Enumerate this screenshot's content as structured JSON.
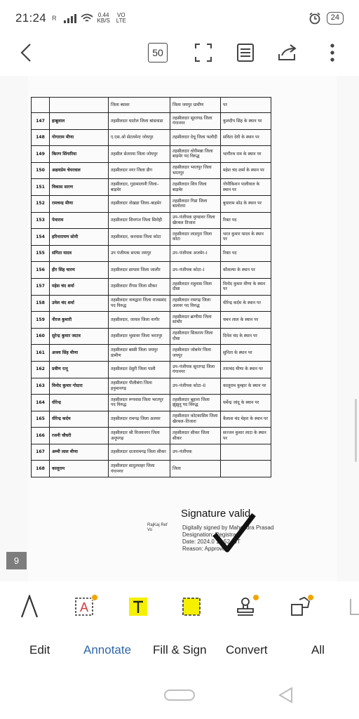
{
  "status_bar": {
    "time": "21:24",
    "net_speed_value": "0.44",
    "net_speed_unit": "KB/S",
    "volte_top": "VO",
    "volte_bottom": "LTE",
    "battery": "24"
  },
  "toolbar": {
    "page_count": "50"
  },
  "document": {
    "header": {
      "from": "जिला ब्यावर",
      "to": "जिला जयपुर ग्रामीण",
      "post": "पर"
    },
    "rows": [
      {
        "num": "147",
        "name": "हाबूलाल",
        "from": "तहसीलदार घाटोल जिला बांसवाडा",
        "to": "तहसीलदार सूरतगढ जिला गंगानगर",
        "post": "कुलदीप सिंह के स्थान पर"
      },
      {
        "num": "148",
        "name": "गोगाराम मीणा",
        "from": "ए.एस.ओ सेटलमेन्ट जोधपुर",
        "to": "तहसीलदार देचू जिला फलौदी",
        "post": "सविता देवी के स्थान पर"
      },
      {
        "num": "149",
        "name": "किरण सिंगारिया",
        "from": "तहसील सेतराया जिला जोधपुर",
        "to": "तहसीलदार धोरीमन्ना जिला बाड़मेर पद विरुद्ध",
        "post": "भागीरथ राम के स्थान पर"
      },
      {
        "num": "150",
        "name": "अक्षयप्रेम चेयरवाल",
        "from": "तहसीलदार नगर जिला डीग",
        "to": "तहसीलदार भरतपुर जिला भरतपुर",
        "post": "महेश चंद शर्मा के स्थान पर"
      },
      {
        "num": "151",
        "name": "विकास सारण",
        "from": "तहसीलदार, गुडामालानी जिला–बाड़मेर",
        "to": "तहसीलदार शिव जिला बाड़मेर",
        "post": "गोपीकिशन पालीवाल के स्थान पर"
      },
      {
        "num": "152",
        "name": "रामचन्द्र मीणा",
        "from": "तहसीलदार नोखडा जिला–बाड़मेर",
        "to": "तहसीलदार गिडा जिला बालोतरा",
        "post": "बुधाराम सोउ के स्थान पर"
      },
      {
        "num": "153",
        "name": "पेमाराम",
        "from": "तहसीलदार शिवगंज जिला सिरोही",
        "to": "उप–पंजीयक मुण्डावर जिला खैरथल तिजारा",
        "post": "रिक्त पद"
      },
      {
        "num": "154",
        "name": "हरिनारायण सोनी",
        "from": "तहसीलदार, कनवास जिला कोटा",
        "to": "तहसीलदार लाडपुरा जिला कोटा",
        "post": "भरत कुमार यादव के स्थान पर"
      },
      {
        "num": "155",
        "name": "संगिता यादव",
        "from": "उप पंजीयक सप्तम जयपुर",
        "to": "उप–पंजीयक अजमेर–I",
        "post": "रिक्त पद"
      },
      {
        "num": "156",
        "name": "हीर सिंह चारण",
        "from": "तहसीलदार सायला जिला जालौर",
        "to": "उप–पंजीयक कोटा–I",
        "post": "कौशल्या के स्थान पर"
      },
      {
        "num": "157",
        "name": "महेश चंद शर्मा",
        "from": "तहसीलदार रींगस जिला सीकर",
        "to": "तहसीलदार राहुवास जिला दौसा",
        "post": "विनोद कुमार मीणा के स्थान पर"
      },
      {
        "num": "158",
        "name": "उमेश चंद शर्मा",
        "from": "तहसीलदार नाथद्वारा जिला राजसमंद पद विरुद्ध",
        "to": "तहसीलदार रामगढ़ जिला अलवर पद विरुद्ध",
        "post": "धीरेन्द्र कर्दम के स्थान पर"
      },
      {
        "num": "159",
        "name": "नीरज कुमारी",
        "from": "तहसीलदार, जायल जिला नागौर",
        "to": "तहसीलदार ब्राणीया जिला सांचौर",
        "post": "चमन लाल के स्थान पर"
      },
      {
        "num": "160",
        "name": "सुरेन्द्र कुमार जाटव",
        "from": "तहसीलदार भुसावर जिला भरतपुर",
        "to": "तहसीलदार सिकराय जिला दौसा",
        "post": "दिनेश चंद के स्थान पर"
      },
      {
        "num": "161",
        "name": "अजय सिंह मीणा",
        "from": "तहसीलदार बस्सी जिला जयपुर ग्रामीण",
        "to": "तहसीलदार जोबनेर जिला जयपुर",
        "post": "सुनिता के स्थान पर"
      },
      {
        "num": "162",
        "name": "प्रवीण रत्नू",
        "from": "तहसीलदार देसुरी जिला पाली",
        "to": "उप–पंजीयक सूरतगढ़ जिला गंगानगर",
        "post": "ताराचंद मीणा के स्थान पर"
      },
      {
        "num": "163",
        "name": "विनोद कुमार गोदारा",
        "from": "तहसीलदार पीलीबंगा जिला हनुमानगढ़",
        "to": "उप–पंजीयक कोटा–II",
        "post": "कालूराम कुम्हार के स्थान पर"
      },
      {
        "num": "164",
        "name": "धीरेन्द्र",
        "from": "तहसीलदार रूपवास जिला भरतपुर पद विरुद्ध",
        "to": "तहसीलदार बुहाना जिला झुंझुनू पद विरुद्ध",
        "post": "धर्मेन्द्र जांदू के स्थान पर"
      },
      {
        "num": "165",
        "name": "धीरेन्द्र कर्दम",
        "from": "तहसीलदार रामगढ़ जिला अलवर",
        "to": "तहसीलदार कोटकासिम जिला खैरथल–तिजारा",
        "post": "कैलाश चंद मेहरा के स्थान पर"
      },
      {
        "num": "166",
        "name": "रजनी चौधरी",
        "from": "तहसीलदार श्री विजयनगर जिला अनूपगढ़",
        "to": "तहसीलदार सीकर जिला सीकर",
        "post": "सज्जन कुमार लाटा के स्थान पर"
      },
      {
        "num": "167",
        "name": "अम्मी लाल मीणा",
        "from": "तहसीलदार दातारामगढ़ जिला सीकर",
        "to": "उप–पंजीयक",
        "post": ""
      },
      {
        "num": "168",
        "name": "कालूराम",
        "from": "तहसीलदार सादुलशहर जिला गंगानगर",
        "to": "जिला",
        "post": ""
      }
    ],
    "signature": {
      "valid_text": "Signature valid",
      "line1": "Digitally signed by Mahendra Prasad",
      "line2": "Designation: Registrar",
      "line3": "Date: 2024.0 16:52 IST",
      "line4": "Reason: Approved",
      "tiny1": "RajKaj Ref",
      "tiny2": "Vo"
    },
    "page_number": "9"
  },
  "tools": {
    "items": [
      "pen",
      "text-box",
      "highlight",
      "area-highlight",
      "stamp",
      "shapes",
      "more"
    ]
  },
  "tabs": [
    {
      "label": "Edit",
      "active": false
    },
    {
      "label": "Annotate",
      "active": true
    },
    {
      "label": "Fill & Sign",
      "active": false
    },
    {
      "label": "Convert",
      "active": false
    },
    {
      "label": "All",
      "active": false
    }
  ],
  "colors": {
    "accent": "#2f66a8",
    "highlight_yellow": "#f5f000",
    "premium_badge": "#f0a500",
    "text_tool_red": "#d23a3a"
  }
}
